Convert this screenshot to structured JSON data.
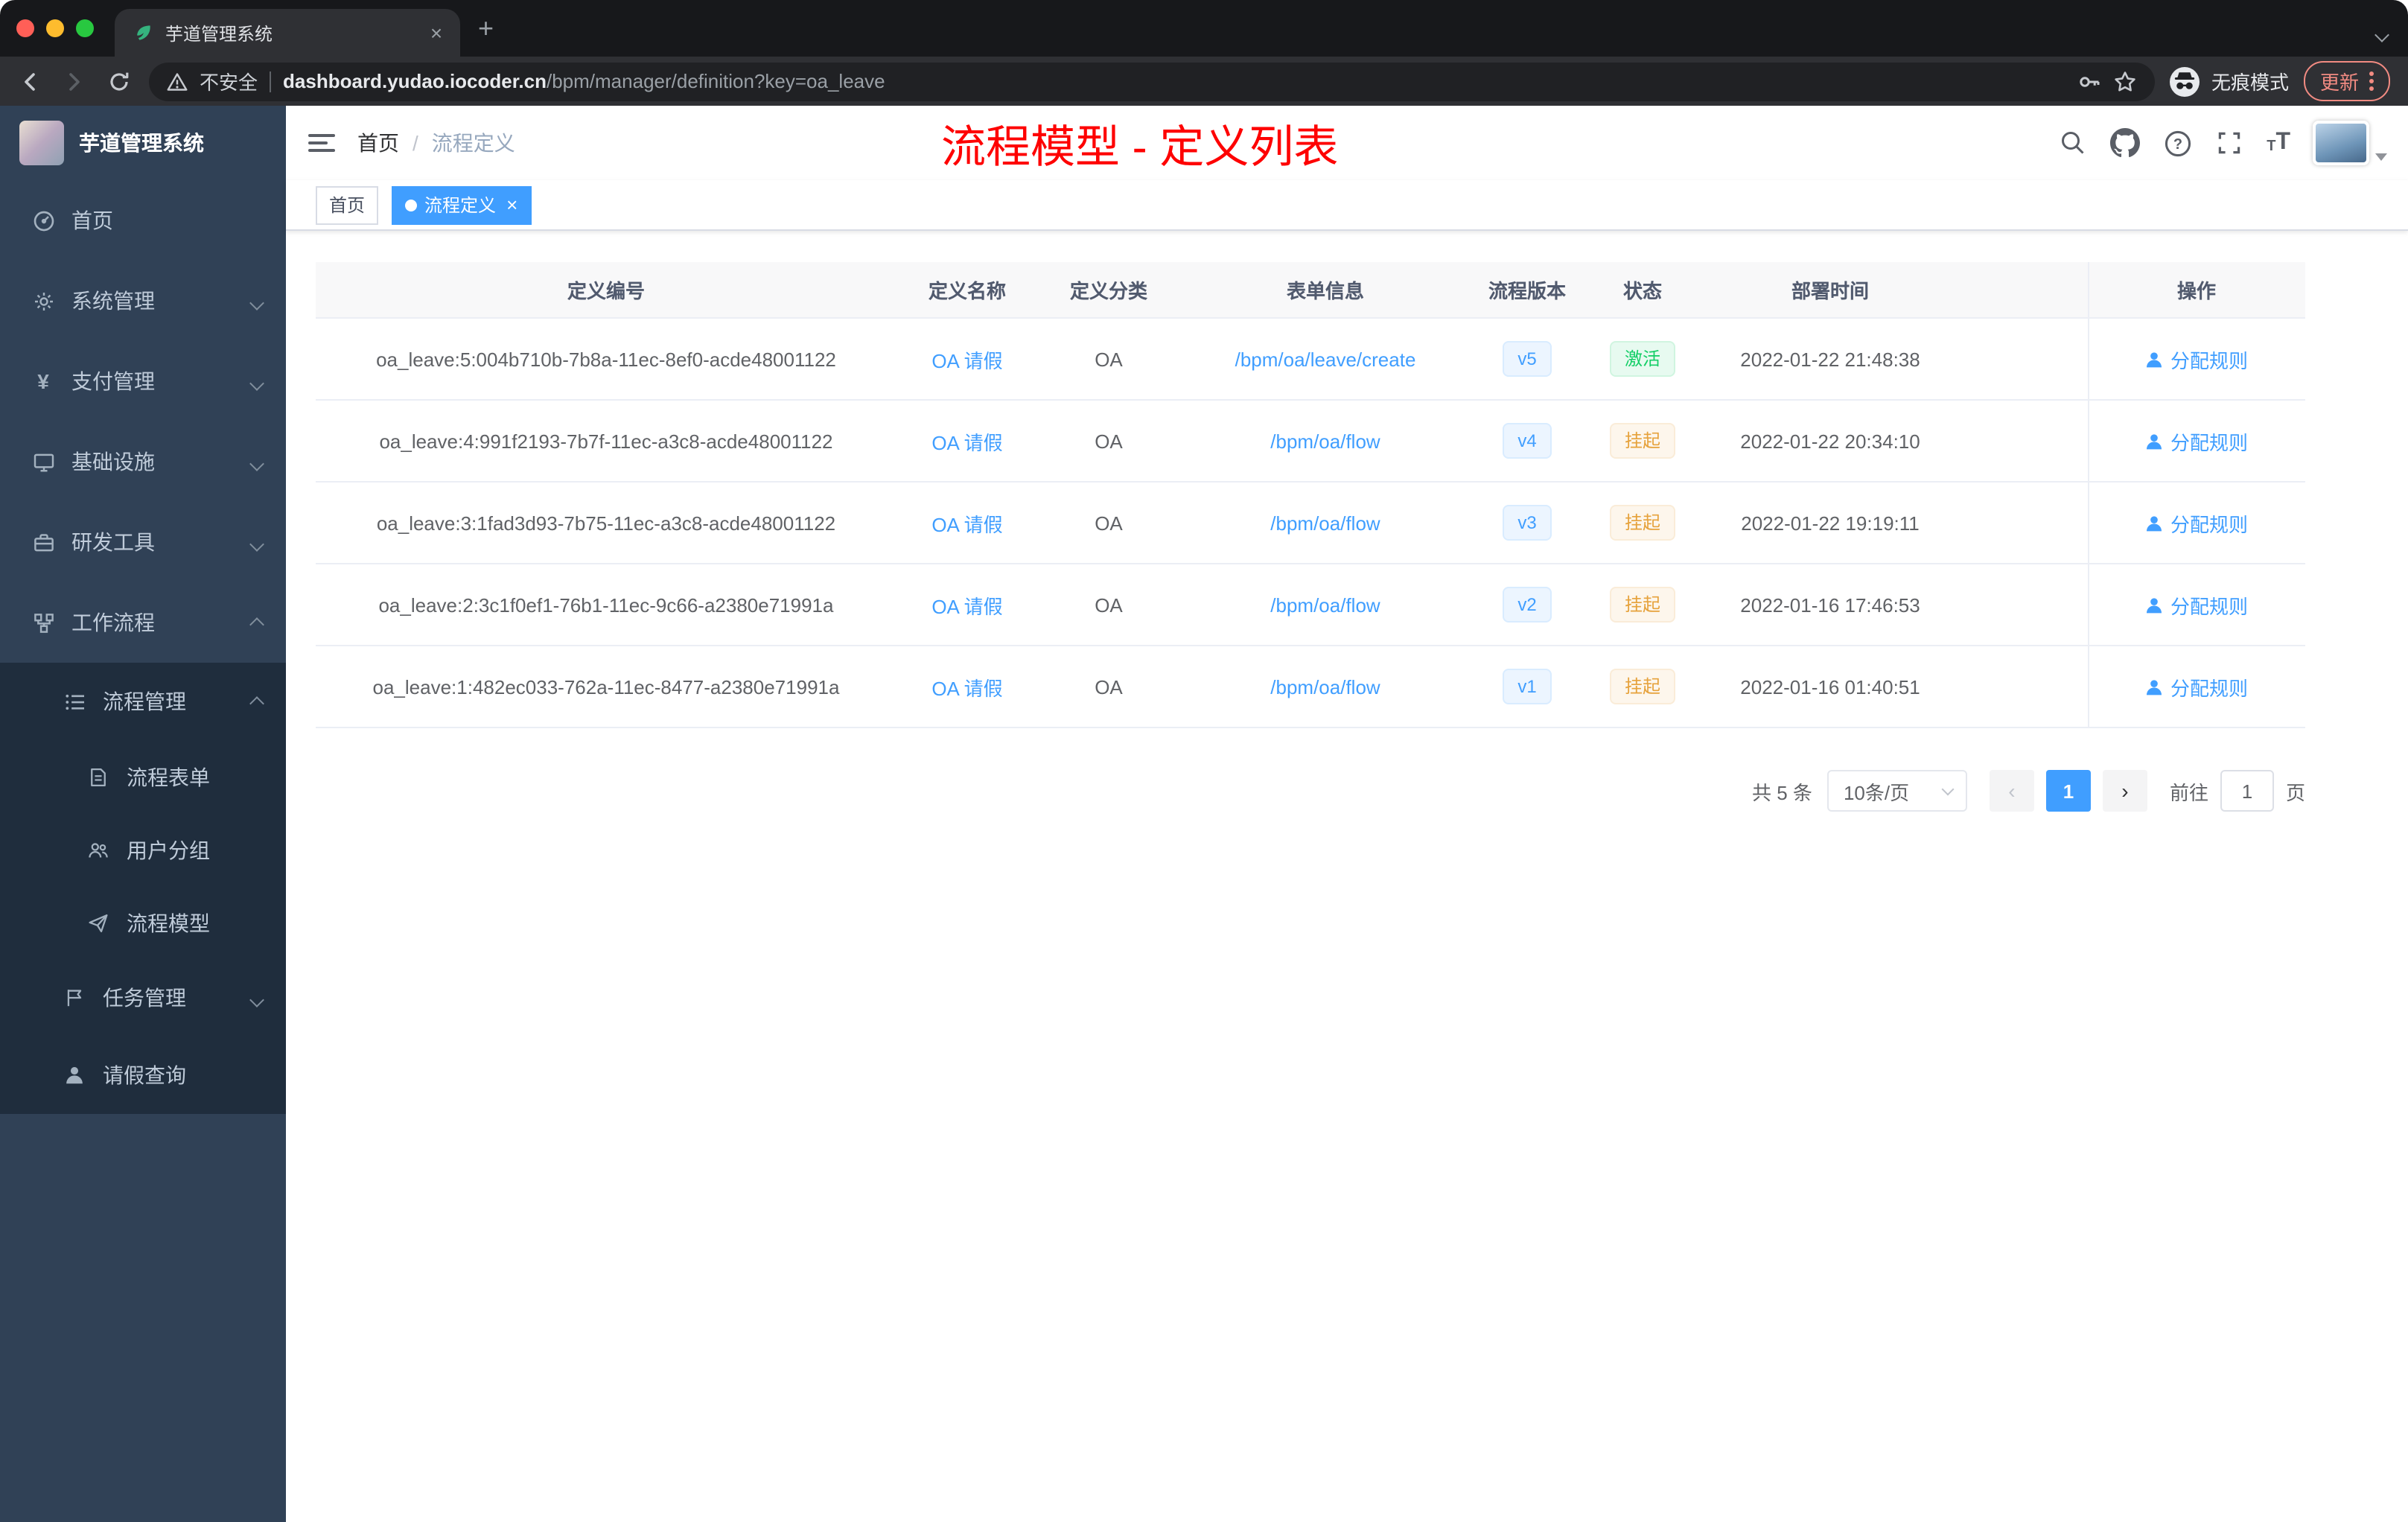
{
  "browser": {
    "tab": {
      "title": "芋道管理系统"
    },
    "address": {
      "security_label": "不安全",
      "host": "dashboard.yudao.iocoder.cn",
      "path": "/bpm/manager/definition?key=oa_leave"
    },
    "incognito_label": "无痕模式",
    "update_label": "更新"
  },
  "sidebar": {
    "title": "芋道管理系统",
    "items": [
      {
        "label": "首页",
        "icon": "dashboard-icon"
      },
      {
        "label": "系统管理",
        "icon": "gear-icon"
      },
      {
        "label": "支付管理",
        "icon": "yen-icon"
      },
      {
        "label": "基础设施",
        "icon": "monitor-icon"
      },
      {
        "label": "研发工具",
        "icon": "toolbox-icon"
      },
      {
        "label": "工作流程",
        "icon": "sitemap-icon"
      },
      {
        "label": "流程管理",
        "icon": "list-icon"
      },
      {
        "label": "流程表单",
        "icon": "document-icon"
      },
      {
        "label": "用户分组",
        "icon": "users-icon"
      },
      {
        "label": "流程模型",
        "icon": "paper-plane-icon"
      },
      {
        "label": "任务管理",
        "icon": "flag-icon"
      },
      {
        "label": "请假查询",
        "icon": "user-icon"
      }
    ]
  },
  "navbar": {
    "breadcrumb": {
      "home": "首页",
      "current": "流程定义"
    },
    "annotation": "流程模型 - 定义列表"
  },
  "tags": {
    "home": "首页",
    "active": "流程定义"
  },
  "table": {
    "columns": [
      "定义编号",
      "定义名称",
      "定义分类",
      "表单信息",
      "流程版本",
      "状态",
      "部署时间",
      "操作"
    ],
    "action_label": "分配规则",
    "rows": [
      {
        "id": "oa_leave:5:004b710b-7b8a-11ec-8ef0-acde48001122",
        "name": "OA 请假",
        "category": "OA",
        "form": "/bpm/oa/leave/create",
        "version": "v5",
        "status": "激活",
        "time": "2022-01-22 21:48:38"
      },
      {
        "id": "oa_leave:4:991f2193-7b7f-11ec-a3c8-acde48001122",
        "name": "OA 请假",
        "category": "OA",
        "form": "/bpm/oa/flow",
        "version": "v4",
        "status": "挂起",
        "time": "2022-01-22 20:34:10"
      },
      {
        "id": "oa_leave:3:1fad3d93-7b75-11ec-a3c8-acde48001122",
        "name": "OA 请假",
        "category": "OA",
        "form": "/bpm/oa/flow",
        "version": "v3",
        "status": "挂起",
        "time": "2022-01-22 19:19:11"
      },
      {
        "id": "oa_leave:2:3c1f0ef1-76b1-11ec-9c66-a2380e71991a",
        "name": "OA 请假",
        "category": "OA",
        "form": "/bpm/oa/flow",
        "version": "v2",
        "status": "挂起",
        "time": "2022-01-16 17:46:53"
      },
      {
        "id": "oa_leave:1:482ec033-762a-11ec-8477-a2380e71991a",
        "name": "OA 请假",
        "category": "OA",
        "form": "/bpm/oa/flow",
        "version": "v1",
        "status": "挂起",
        "time": "2022-01-16 01:40:51"
      }
    ]
  },
  "pagination": {
    "total_label": "共 5 条",
    "page_size": "10条/页",
    "current_page": "1",
    "goto_label": "前往",
    "goto_value": "1",
    "unit_label": "页"
  },
  "colors": {
    "accent": "#409eff",
    "annotation_red": "#fe0000",
    "sidebar_bg": "#304156",
    "submenu_bg": "#1f2d3d",
    "status_active_green": "#13ce66",
    "status_suspend_orange": "#e6a23c"
  }
}
